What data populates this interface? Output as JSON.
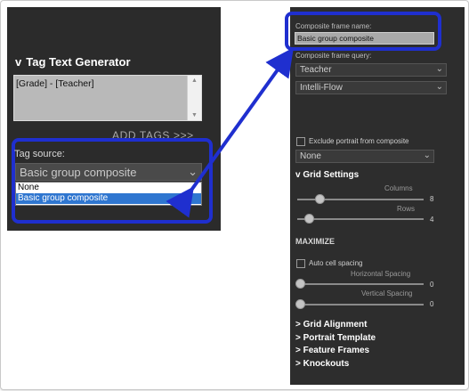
{
  "left_panel": {
    "tag_text_generator": {
      "chevron": "v",
      "label": "Tag Text Generator"
    },
    "tag_textarea_value": "[Grade] - [Teacher]",
    "add_tags_label": "ADD TAGS >>>",
    "tag_source": {
      "label": "Tag source:",
      "selected": "Basic group composite",
      "options": [
        "None",
        "Basic group composite"
      ],
      "highlighted_option": "Basic group composite"
    }
  },
  "right_panel": {
    "composite_frame_name": {
      "label": "Composite frame name:",
      "value": "Basic group composite"
    },
    "composite_frame_query": {
      "label": "Composite frame query:",
      "select1": "Teacher",
      "select2": "Intelli-Flow"
    },
    "exclude_portrait": {
      "label": "Exclude portrait from composite",
      "checked": false
    },
    "exclude_select": "None",
    "grid_settings": {
      "chevron": "v",
      "label": "Grid Settings",
      "columns_label": "Columns",
      "columns_value": "8",
      "rows_label": "Rows",
      "rows_value": "4"
    },
    "maximize_label": "MAXIMIZE",
    "auto_cell_spacing": {
      "label": "Auto cell spacing",
      "checked": false
    },
    "horizontal_spacing": {
      "label": "Horizontal Spacing",
      "value": "0"
    },
    "vertical_spacing": {
      "label": "Vertical Spacing",
      "value": "0"
    },
    "sections": [
      "> Grid Alignment",
      "> Portrait Template",
      "> Feature Frames",
      "> Knockouts"
    ]
  },
  "colors": {
    "highlight_box": "#1f2fcf",
    "panel_bg": "#2d2d2d",
    "selected_option": "#2f76d0"
  }
}
